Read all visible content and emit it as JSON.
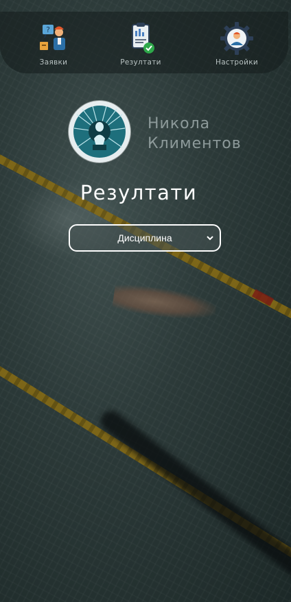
{
  "nav": {
    "items": [
      {
        "label": "Заявки",
        "icon": "applications-icon"
      },
      {
        "label": "Резултати",
        "icon": "results-clipboard-icon"
      },
      {
        "label": "Настройки",
        "icon": "settings-gear-icon"
      }
    ]
  },
  "profile": {
    "first_name": "Никола",
    "last_name": "Климентов"
  },
  "page": {
    "title": "Резултати"
  },
  "discipline_select": {
    "value": "Дисциплина"
  },
  "colors": {
    "title": "#ffffff",
    "name": "#8d9a9a",
    "lane": "#8a6d12",
    "check": "#2ea84a"
  }
}
